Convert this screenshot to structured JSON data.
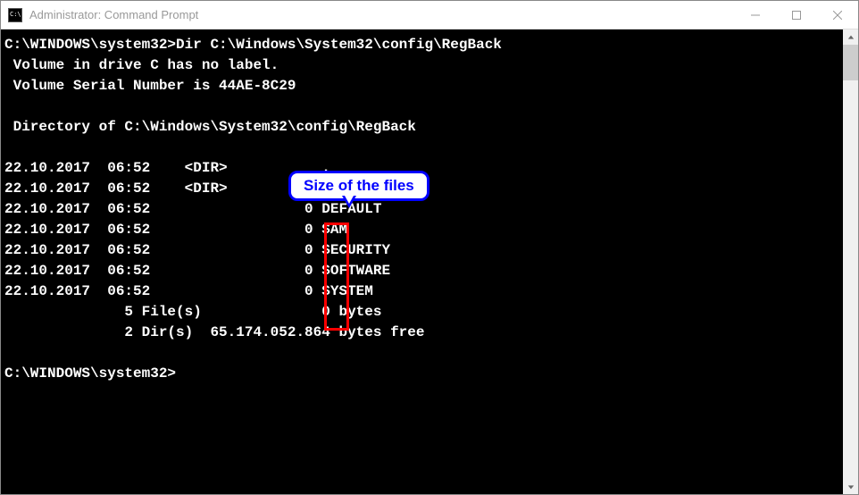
{
  "window": {
    "title": "Administrator: Command Prompt"
  },
  "terminal": {
    "prompt1": "C:\\WINDOWS\\system32>",
    "command": "Dir C:\\Windows\\System32\\config\\RegBack",
    "volume_line": " Volume in drive C has no label.",
    "serial_line": " Volume Serial Number is 44AE-8C29",
    "dir_line": " Directory of C:\\Windows\\System32\\config\\RegBack",
    "entries": [
      {
        "date": "22.10.2017",
        "time": "06:52",
        "marker": "<DIR>",
        "size": "",
        "name": "."
      },
      {
        "date": "22.10.2017",
        "time": "06:52",
        "marker": "<DIR>",
        "size": "",
        "name": ".."
      },
      {
        "date": "22.10.2017",
        "time": "06:52",
        "marker": "",
        "size": "0",
        "name": "DEFAULT"
      },
      {
        "date": "22.10.2017",
        "time": "06:52",
        "marker": "",
        "size": "0",
        "name": "SAM"
      },
      {
        "date": "22.10.2017",
        "time": "06:52",
        "marker": "",
        "size": "0",
        "name": "SECURITY"
      },
      {
        "date": "22.10.2017",
        "time": "06:52",
        "marker": "",
        "size": "0",
        "name": "SOFTWARE"
      },
      {
        "date": "22.10.2017",
        "time": "06:52",
        "marker": "",
        "size": "0",
        "name": "SYSTEM"
      }
    ],
    "summary_files": "              5 File(s)              0 bytes",
    "summary_dirs": "              2 Dir(s)  65.174.052.864 bytes free",
    "prompt2": "C:\\WINDOWS\\system32>"
  },
  "annotation": {
    "label": "Size of the files"
  }
}
